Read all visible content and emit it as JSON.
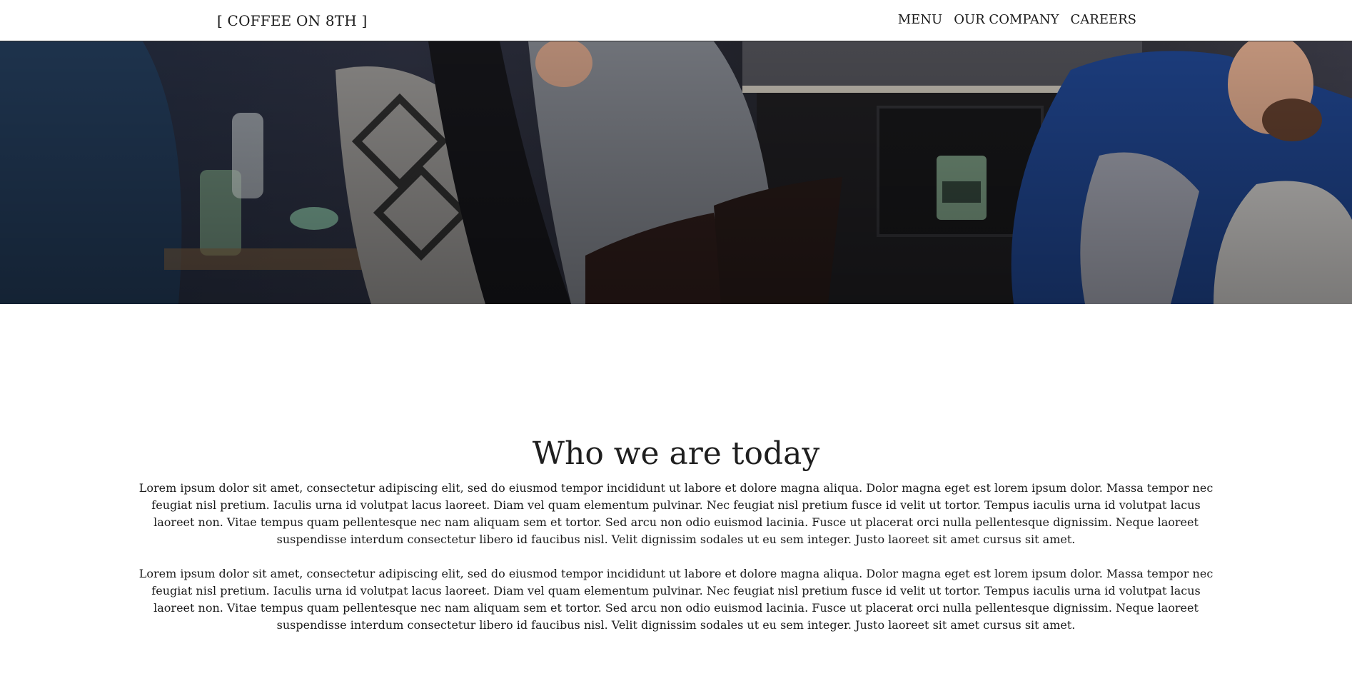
{
  "nav": {
    "logo": "[ COFFEE ON 8TH ]",
    "links": [
      "MENU",
      "OUR COMPANY",
      "CAREERS"
    ]
  },
  "hero": {
    "image": "coffee-shop-interior-photo"
  },
  "content": {
    "title": "Who we are today",
    "paragraphs": [
      "Lorem ipsum dolor sit amet, consectetur adipiscing elit, sed do eiusmod tempor incididunt ut labore et dolore magna aliqua. Dolor magna eget est lorem ipsum dolor. Massa tempor nec feugiat nisl pretium. Iaculis urna id volutpat lacus laoreet. Diam vel quam elementum pulvinar. Nec feugiat nisl pretium fusce id velit ut tortor. Tempus iaculis urna id volutpat lacus laoreet non. Vitae tempus quam pellentesque nec nam aliquam sem et tortor. Sed arcu non odio euismod lacinia. Fusce ut placerat orci nulla pellentesque dignissim. Neque laoreet suspendisse interdum consectetur libero id faucibus nisl. Velit dignissim sodales ut eu sem integer. Justo laoreet sit amet cursus sit amet.",
      "Lorem ipsum dolor sit amet, consectetur adipiscing elit, sed do eiusmod tempor incididunt ut labore et dolore magna aliqua. Dolor magna eget est lorem ipsum dolor. Massa tempor nec feugiat nisl pretium. Iaculis urna id volutpat lacus laoreet. Diam vel quam elementum pulvinar. Nec feugiat nisl pretium fusce id velit ut tortor. Tempus iaculis urna id volutpat lacus laoreet non. Vitae tempus quam pellentesque nec nam aliquam sem et tortor. Sed arcu non odio euismod lacinia. Fusce ut placerat orci nulla pellentesque dignissim. Neque laoreet suspendisse interdum consectetur libero id faucibus nisl. Velit dignissim sodales ut eu sem integer. Justo laoreet sit amet cursus sit amet."
    ]
  },
  "colors": {
    "background": "#ffffff",
    "text": "#1a1a1a",
    "nav_border": "#333333"
  }
}
